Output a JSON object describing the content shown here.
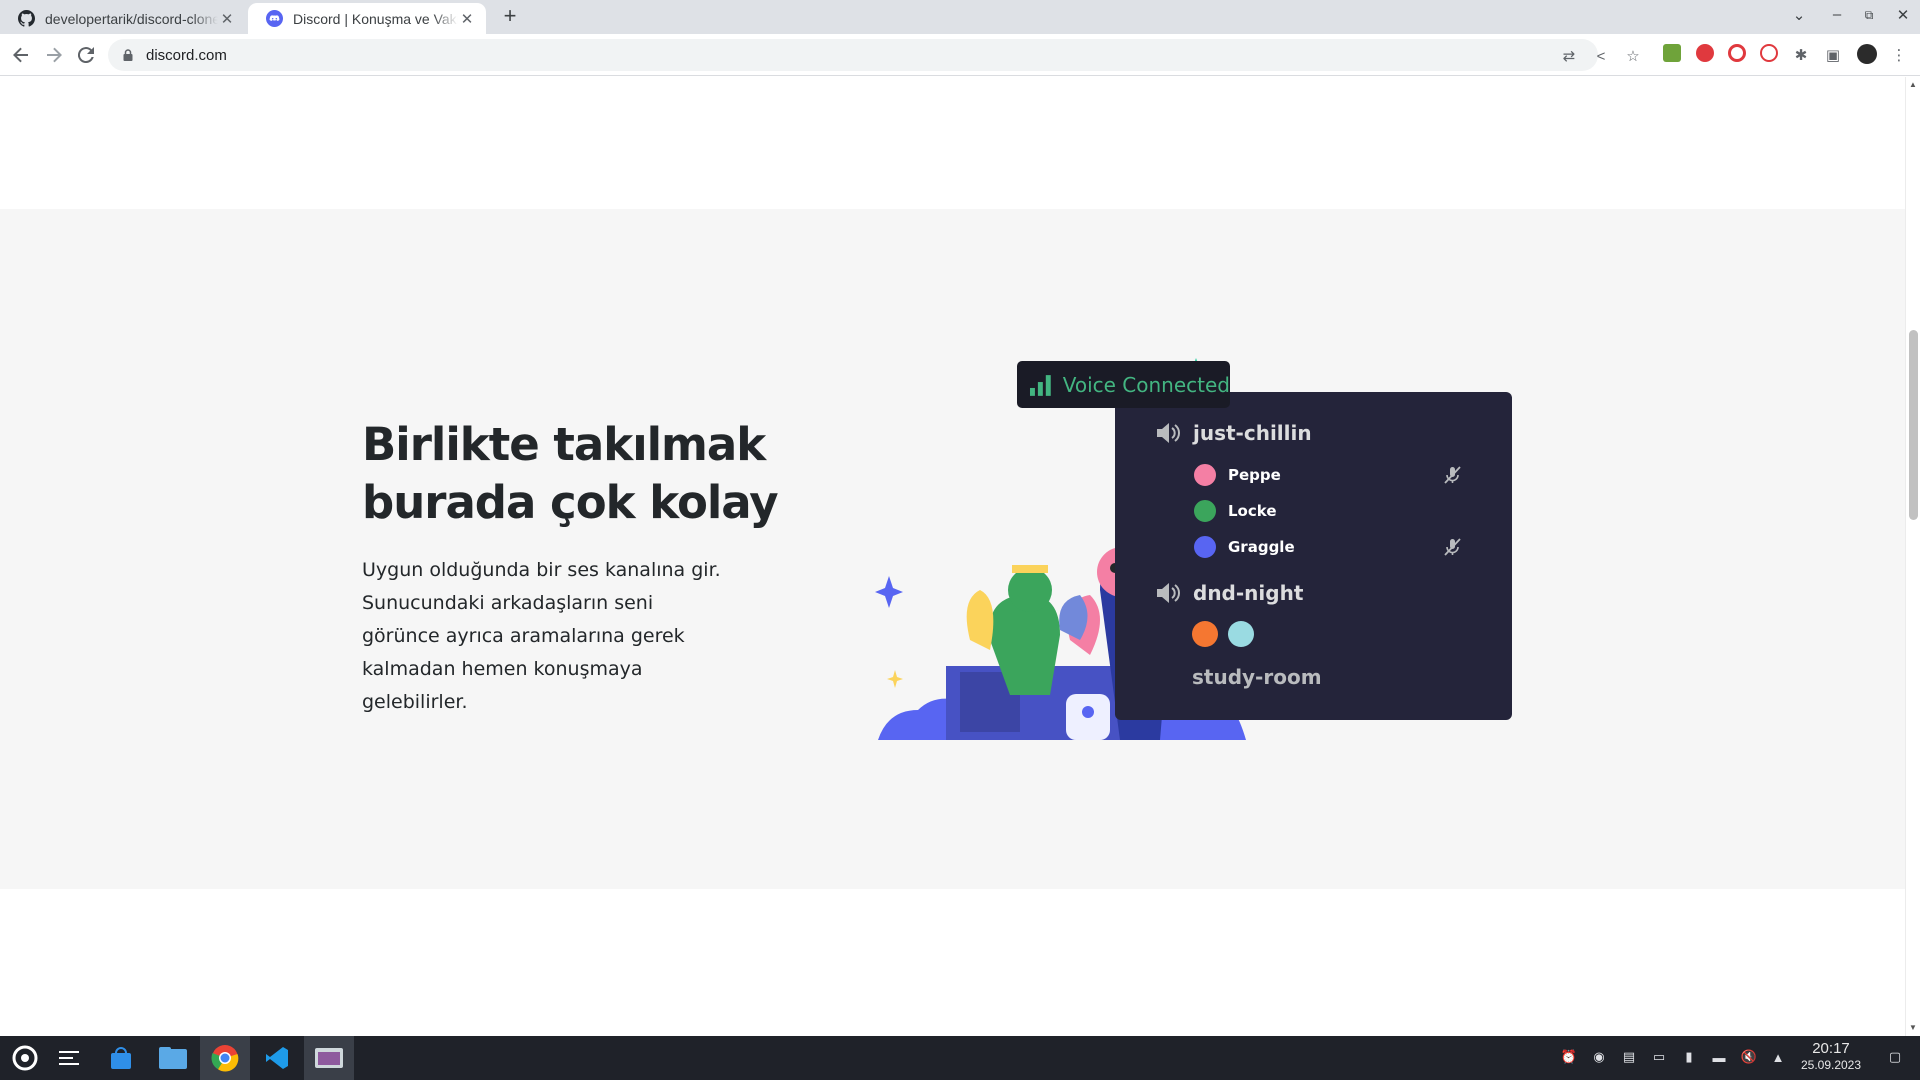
{
  "browser": {
    "tabs": [
      {
        "title": "developertarik/discord-clone",
        "icon": "github-icon",
        "active": false
      },
      {
        "title": "Discord | Konuşma ve Vakit Geçirme Yeri",
        "icon": "discord-icon",
        "active": true
      }
    ],
    "new_tab": "+",
    "url": "discord.com"
  },
  "section": {
    "headline_line1": "Birlikte takılmak",
    "headline_line2": "burada çok kolay",
    "body": "Uygun olduğunda bir ses kanalına gir. Sunucundaki arkadaşların seni görünce ayrıca aramalarına gerek kalmadan hemen konuşmaya gelebilirler."
  },
  "voice": {
    "status": "Voice Connected",
    "status_color": "#43b581",
    "channels": [
      {
        "name": "just-chillin"
      },
      {
        "name": "dnd-night"
      },
      {
        "name": "study-room"
      }
    ],
    "users": [
      {
        "name": "Peppe",
        "muted": true,
        "avatar_color": "#f47fa4"
      },
      {
        "name": "Locke",
        "muted": false,
        "avatar_color": "#3ba55c"
      },
      {
        "name": "Graggle",
        "muted": true,
        "avatar_color": "#5865f2"
      }
    ]
  },
  "taskbar": {
    "time": "20:17",
    "date": "25.09.2023"
  }
}
